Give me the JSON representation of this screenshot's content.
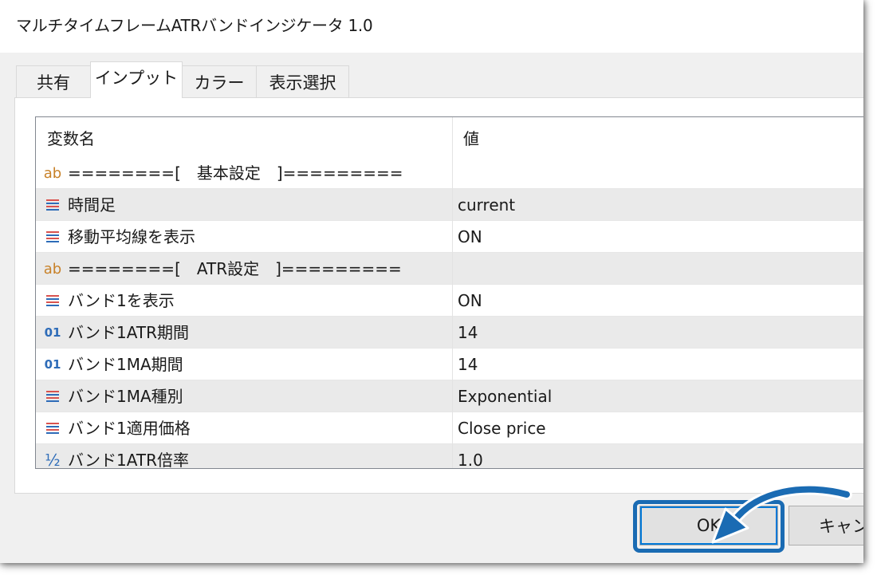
{
  "window": {
    "title": "マルチタイムフレームATRバンドインジケータ 1.0"
  },
  "tabs": [
    {
      "label": "共有"
    },
    {
      "label": "インプット",
      "active": true
    },
    {
      "label": "カラー"
    },
    {
      "label": "表示選択"
    }
  ],
  "grid": {
    "header": {
      "name": "変数名",
      "value": "値"
    },
    "rows": [
      {
        "icon": "ab-icon",
        "name": "========[　基本設定　]=========",
        "value": ""
      },
      {
        "icon": "enum-icon",
        "name": "時間足",
        "value": "current"
      },
      {
        "icon": "enum-icon",
        "name": "移動平均線を表示",
        "value": "ON"
      },
      {
        "icon": "ab-icon",
        "name": "========[　ATR設定　]=========",
        "value": ""
      },
      {
        "icon": "enum-icon",
        "name": "バンド1を表示",
        "value": "ON"
      },
      {
        "icon": "int-icon",
        "name": "バンド1ATR期間",
        "value": "14"
      },
      {
        "icon": "int-icon",
        "name": "バンド1MA期間",
        "value": "14"
      },
      {
        "icon": "enum-icon",
        "name": "バンド1MA種別",
        "value": "Exponential"
      },
      {
        "icon": "enum-icon",
        "name": "バンド1適用価格",
        "value": "Close price"
      },
      {
        "icon": "double-icon",
        "name": "バンド1ATR倍率",
        "value": "1.0"
      }
    ]
  },
  "icons": {
    "ab": "ab",
    "int": "01",
    "double": "½"
  },
  "buttons": {
    "ok": "OK",
    "cancel": "キャン"
  },
  "colors": {
    "highlight": "#1a6bb3",
    "enum_icon_red": "#d9534f",
    "enum_icon_blue": "#2e6cb8"
  }
}
